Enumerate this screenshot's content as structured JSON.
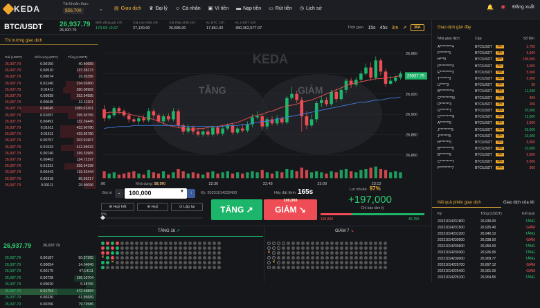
{
  "header": {
    "logo": "KEDA",
    "account_label": "Tài khoản thực",
    "account_balance": "$56,700",
    "nav": [
      "Giao dịch",
      "Đại lý",
      "Cá nhân",
      "Ví tiền",
      "Nạp tiền",
      "Rút tiền",
      "Lịch sử"
    ],
    "logout": "Đăng xuất"
  },
  "stats": {
    "pair": "BTC/USDT",
    "price": "26,937.79",
    "price_sub": "26,937.79",
    "items": [
      {
        "label": "Biến động giá 24h",
        "value": "179.93 +0.67"
      },
      {
        "label": "Giá cao nhất 24h",
        "value": "27,130.00"
      },
      {
        "label": "Giá thấp nhất 24h",
        "value": "26,685.00"
      },
      {
        "label": "KL BTC 24h",
        "value": "17,861.92"
      },
      {
        "label": "KL USDT 24h",
        "value": "480,362,577.07"
      }
    ],
    "time_label": "Thời gian",
    "timeframes": [
      "15s",
      "45s",
      "3m"
    ],
    "active_timeframe": "3m",
    "ma_label": "MA"
  },
  "market": {
    "title": "Thị trường giao dịch",
    "headers": [
      "Giá (USDT)",
      "Số lượng (BTC)",
      "Tổng (USDT)"
    ],
    "asks": [
      [
        "26,937.79",
        "0.00150",
        "40.40689"
      ],
      [
        "26,937.79",
        "0.00510",
        "137.38273"
      ],
      [
        "26,937.79",
        "0.00074",
        "19.93396"
      ],
      [
        "26,937.79",
        "0.01240",
        "334.02860"
      ],
      [
        "26,937.79",
        "0.01411",
        "380.08982"
      ],
      [
        "26,937.79",
        "0.00939",
        "252.94585"
      ],
      [
        "26,937.79",
        "0.00045",
        "12.12201"
      ],
      [
        "26,937.79",
        "0.04045",
        "1089.63361"
      ],
      [
        "26,937.79",
        "0.01097",
        "295.50756"
      ],
      [
        "26,937.79",
        "0.00491",
        "132.26445"
      ],
      [
        "26,937.79",
        "0.01611",
        "433.96780"
      ],
      [
        "26,937.79",
        "0.01611",
        "433.96780"
      ],
      [
        "26,937.79",
        "0.00757",
        "203.91907"
      ],
      [
        "26,937.79",
        "0.01533",
        "412.95632"
      ],
      [
        "26,937.79",
        "0.00740",
        "199.33965"
      ],
      [
        "26,937.79",
        "0.00463",
        "124.72197"
      ],
      [
        "26,937.79",
        "0.01331",
        "358.54198"
      ],
      [
        "26,937.79",
        "0.00443",
        "119.33444"
      ],
      [
        "26,937.79",
        "0.00318",
        "85.66217"
      ],
      [
        "26,937.79",
        "0.00111",
        "29.90096"
      ]
    ],
    "mid_price": "26,937.79",
    "mid_sub": "26,937.79",
    "bids": [
      [
        "26,937.79",
        "0.00187",
        "50.37365"
      ],
      [
        "26,937.79",
        "0.00054",
        "14.54640"
      ],
      [
        "26,937.79",
        "0.00175",
        "47.14111"
      ],
      [
        "26,937.79",
        "0.00728",
        "196.10704"
      ],
      [
        "26,937.79",
        "0.00020",
        "5.38756"
      ],
      [
        "26,937.79",
        "0.01754",
        "472.48884"
      ],
      [
        "26,937.79",
        "0.00230",
        "61.95689"
      ],
      [
        "26,937.79",
        "0.00296",
        "79.73586"
      ]
    ]
  },
  "chart_data": {
    "type": "candlestick",
    "watermark": "KEDA",
    "watermark_bull": "TĂNG",
    "watermark_bear": "GIẢM",
    "y_ticks": [
      "26,960",
      "26,940",
      "26,920",
      "26,900",
      "26,880",
      "26,860"
    ],
    "ylim": [
      26850,
      26968
    ],
    "x_ticks": [
      ":00",
      "22:24",
      "22:36",
      "22:48",
      "23:00",
      "23:12"
    ],
    "current_price": "26937.79",
    "candles": [
      [
        26905,
        26896,
        26909,
        26893
      ],
      [
        26896,
        26899,
        26901,
        26894
      ],
      [
        26899,
        26906,
        26908,
        26897
      ],
      [
        26906,
        26903,
        26908,
        26900
      ],
      [
        26903,
        26899,
        26905,
        26897
      ],
      [
        26899,
        26895,
        26902,
        26892
      ],
      [
        26895,
        26893,
        26897,
        26891
      ],
      [
        26893,
        26896,
        26898,
        26890
      ],
      [
        26896,
        26894,
        26899,
        26892
      ],
      [
        26894,
        26903,
        26906,
        26892
      ],
      [
        26903,
        26899,
        26905,
        26896
      ],
      [
        26899,
        26893,
        26901,
        26891
      ],
      [
        26893,
        26898,
        26900,
        26890
      ],
      [
        26898,
        26895,
        26901,
        26893
      ],
      [
        26895,
        26903,
        26906,
        26893
      ],
      [
        26903,
        26889,
        26905,
        26887
      ],
      [
        26889,
        26883,
        26891,
        26880
      ],
      [
        26883,
        26887,
        26890,
        26881
      ],
      [
        26887,
        26883,
        26889,
        26880
      ],
      [
        26883,
        26880,
        26886,
        26878
      ],
      [
        26880,
        26883,
        26885,
        26878
      ],
      [
        26883,
        26880,
        26886,
        26878
      ],
      [
        26880,
        26887,
        26889,
        26878
      ],
      [
        26887,
        26881,
        26889,
        26879
      ],
      [
        26881,
        26886,
        26888,
        26879
      ],
      [
        26886,
        26889,
        26891,
        26884
      ],
      [
        26889,
        26882,
        26891,
        26880
      ],
      [
        26882,
        26886,
        26888,
        26880
      ],
      [
        26886,
        26884,
        26890,
        26882
      ],
      [
        26884,
        26890,
        26893,
        26882
      ],
      [
        26890,
        26897,
        26900,
        26887
      ],
      [
        26897,
        26898,
        26903,
        26895
      ],
      [
        26898,
        26888,
        26900,
        26885
      ],
      [
        26888,
        26895,
        26897,
        26885
      ],
      [
        26895,
        26891,
        26898,
        26889
      ],
      [
        26891,
        26896,
        26899,
        26889
      ],
      [
        26896,
        26892,
        26898,
        26890
      ],
      [
        26892,
        26916,
        26918,
        26890
      ],
      [
        26916,
        26920,
        26927,
        26914
      ],
      [
        26920,
        26914,
        26923,
        26911
      ],
      [
        26914,
        26898,
        26917,
        26883
      ],
      [
        26898,
        26889,
        26903,
        26885
      ],
      [
        26889,
        26895,
        26900,
        26887
      ],
      [
        26895,
        26911,
        26913,
        26892
      ],
      [
        26911,
        26914,
        26918,
        26907
      ],
      [
        26914,
        26910,
        26917,
        26908
      ],
      [
        26910,
        26922,
        26924,
        26908
      ],
      [
        26922,
        26915,
        26925,
        26912
      ],
      [
        26915,
        26924,
        26927,
        26913
      ],
      [
        26924,
        26933,
        26935,
        26921
      ],
      [
        26933,
        26929,
        26936,
        26926
      ],
      [
        26929,
        26934,
        26937,
        26927
      ],
      [
        26934,
        26940,
        26943,
        26931
      ],
      [
        26940,
        26946,
        26950,
        26938
      ],
      [
        26946,
        26936,
        26951,
        26933
      ],
      [
        26936,
        26953,
        26957,
        26934
      ],
      [
        26953,
        26942,
        26955,
        26938
      ],
      [
        26942,
        26930,
        26945,
        26927
      ],
      [
        26930,
        26933,
        26938,
        26929
      ],
      [
        26933,
        26936,
        26938,
        26931
      ],
      [
        26936,
        26940,
        26942,
        26934
      ]
    ],
    "ma_fast": [
      26901,
      26902,
      26902,
      26902,
      26901,
      26900,
      26899,
      26898,
      26897,
      26896,
      26895,
      26893,
      26891,
      26889,
      26888,
      26887,
      26886,
      26885,
      26885,
      26886,
      26886,
      26887,
      26888,
      26888,
      26889,
      26890,
      26891,
      26892,
      26894,
      26896,
      26898,
      26899,
      26900,
      26902,
      26903,
      26905,
      26907,
      26908,
      26909,
      26910,
      26912,
      26913,
      26914,
      26916,
      26918,
      26920,
      26922,
      26924,
      26926,
      26928,
      26930,
      26931,
      26932,
      26933,
      26934,
      26935,
      26935,
      26936,
      26936,
      26937,
      26938
    ],
    "ma_slow": [
      26886,
      26887,
      26887,
      26888,
      26888,
      26888,
      26889,
      26889,
      26889,
      26889,
      26889,
      26889,
      26889,
      26889,
      26889,
      26889,
      26888,
      26888,
      26888,
      26888,
      26888,
      26888,
      26888,
      26888,
      26888,
      26889,
      26889,
      26889,
      26890,
      26890,
      26891,
      26892,
      26893,
      26893,
      26894,
      26895,
      26896,
      26897,
      26898,
      26899,
      26900,
      26901,
      26902,
      26903,
      26904,
      26905,
      26906,
      26907,
      26908,
      26909,
      26910,
      26911,
      26912,
      26912,
      26913,
      26914,
      26914,
      26915,
      26916,
      26916,
      26917
    ],
    "volumes": [
      6,
      4,
      5,
      3,
      4,
      5,
      6,
      4,
      3,
      7,
      5,
      4,
      6,
      3,
      5,
      8,
      6,
      4,
      5,
      4,
      3,
      5,
      6,
      4,
      5,
      6,
      4,
      5,
      4,
      5,
      6,
      5,
      7,
      5,
      4,
      6,
      5,
      8,
      7,
      6,
      9,
      7,
      5,
      6,
      5,
      4,
      6,
      5,
      7,
      8,
      6,
      5,
      7,
      8,
      9,
      10,
      8,
      7,
      5,
      6,
      5
    ]
  },
  "order": {
    "available_label": "Khả dụng:",
    "available_value": "56,700",
    "amount_label": "Giá trị",
    "amount": "100,000",
    "order_id_label": "Kỳ:",
    "order_id": "20231014232400",
    "countdown_label": "Hãy đặt lệnh:",
    "countdown": "165s",
    "btn_cancel_all": "Huỷ hết",
    "btn_cancel": "Huỷ",
    "btn_repeat": "Lặp lại",
    "slider_value": "0%",
    "up_label": "TĂNG",
    "down_label": "GIẢM",
    "down_amount": "100,000",
    "profit_label": "Lợi nhuận",
    "profit_pct": "97%",
    "profit_value": "+197,000",
    "meter_label": "Chỉ báo tâm lý",
    "meter_left": "130,800",
    "meter_right": "45,750",
    "meter_red_fraction": 0.3
  },
  "bottom": {
    "up_tab": "TĂNG 16",
    "down_tab": "GIẢM 7"
  },
  "recent": {
    "title": "Giao dịch gần đây",
    "headers": [
      "Nhà giao dịch",
      "Cặp",
      "Số tiền"
    ],
    "rows": [
      [
        "A*********4",
        "BTC/USDT",
        "45s",
        "3,700",
        "r"
      ],
      [
        "F*******1",
        "BTC/USDT",
        "45s",
        "5,000",
        "r"
      ],
      [
        "H***0",
        "BTC/USDT",
        "3m",
        "100,000",
        "r"
      ],
      [
        "P*********3",
        "BTC/USDT",
        "3m",
        "3,000",
        "r"
      ],
      [
        "E*********3",
        "BTC/USDT",
        "45s",
        "5,000",
        "r"
      ],
      [
        "T*******3",
        "BTC/USDT",
        "45s",
        "5,000",
        "r"
      ],
      [
        "U*****3",
        "BTC/USDT",
        "45s",
        "50",
        "r"
      ],
      [
        "B*********4",
        "BTC/USDT",
        "15s",
        "11,200",
        "g"
      ],
      [
        "C*********N",
        "BTC/USDT",
        "15s",
        "409",
        "r"
      ],
      [
        "D*******3",
        "BTC/USDT",
        "15s",
        "200",
        "r"
      ],
      [
        "G*******1",
        "BTC/USDT",
        "45s",
        "20,000",
        "g"
      ],
      [
        "O*********8",
        "BTC/USDT",
        "15s",
        "15,000",
        "g"
      ],
      [
        "A*******0",
        "BTC/USDT",
        "15s",
        "3,000",
        "r"
      ],
      [
        "J*********9",
        "BTC/USDT",
        "45s",
        "20,000",
        "g"
      ],
      [
        "J*******8",
        "BTC/USDT",
        "45s",
        "10,000",
        "g"
      ],
      [
        "H*******0",
        "BTC/USDT",
        "3m",
        "5,000",
        "r"
      ],
      [
        "B*********5",
        "BTC/USDT",
        "15s",
        "10,000",
        "g"
      ],
      [
        "B*******6",
        "BTC/USDT",
        "15s",
        "5,000",
        "r"
      ],
      [
        "C*********7",
        "BTC/USDT",
        "45s",
        "5,000",
        "r"
      ],
      [
        "F*********7",
        "BTC/USDT",
        "45s",
        "300",
        "r"
      ]
    ],
    "result_tabs": [
      "Kết quả phiên giao dịch",
      "Giao dịch của tôi"
    ],
    "result_headers": [
      "Kỳ",
      "Tổng (USDT)",
      "Kết quả"
    ],
    "results": [
      [
        "20231014231800",
        "26,930.00",
        "TĂNG",
        "g"
      ],
      [
        "20231014231500",
        "26,925.40",
        "GIẢM",
        "r"
      ],
      [
        "20231014231200",
        "26,940.10",
        "TĂNG",
        "g"
      ],
      [
        "20231014230900",
        "26,938.00",
        "GIẢM",
        "r"
      ],
      [
        "20231014230600",
        "26,950.00",
        "TĂNG",
        "g"
      ],
      [
        "20231014230300",
        "26,926.95",
        "TĂNG",
        "g"
      ],
      [
        "20231014230000",
        "26,909.77",
        "TĂNG",
        "g"
      ],
      [
        "20231014225700",
        "26,897.12",
        "GIẢM",
        "r"
      ],
      [
        "20231014225400",
        "26,901.06",
        "GIẢM",
        "r"
      ],
      [
        "20231014225100",
        "26,904.55",
        "TĂNG",
        "g"
      ]
    ]
  }
}
